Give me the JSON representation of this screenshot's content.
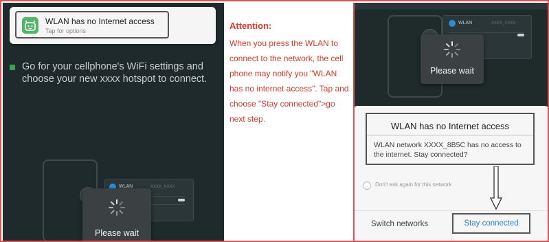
{
  "left_panel": {
    "notification": {
      "title": "WLAN has no Internet access",
      "subtitle": "Tap for options",
      "icon": "android-app-icon"
    },
    "instruction": "Go for your cellphone's WiFi settings and choose your new xxxx hotspot to connect.",
    "wifi_card": {
      "label": "WLAN",
      "network": "XXXX_XXXX"
    },
    "wait_text": "Please wait"
  },
  "attention": {
    "title": "Attention:",
    "body": "When you press the WLAN to connect to the network, the cell phone may notify you \"WLAN has no internet access\". Tap and choose \"Stay connected\">go next step."
  },
  "right_panel": {
    "wifi_card": {
      "label": "WLAN",
      "network": "XXXX_XXXX"
    },
    "wait_text": "Please wait",
    "dialog": {
      "title": "WLAN has no Internet access",
      "message": "WLAN network XXXX_8B5C has no access to the internet. Stay connected?",
      "checkbox_label": "Don't ask again for this network",
      "switch_button": "Switch networks",
      "stay_button": "Stay connected"
    }
  },
  "colors": {
    "frame": "#d6545a",
    "attention_text": "#d83a2b",
    "accent_blue": "#2f7fd0",
    "app_icon_green": "#56b36a"
  }
}
